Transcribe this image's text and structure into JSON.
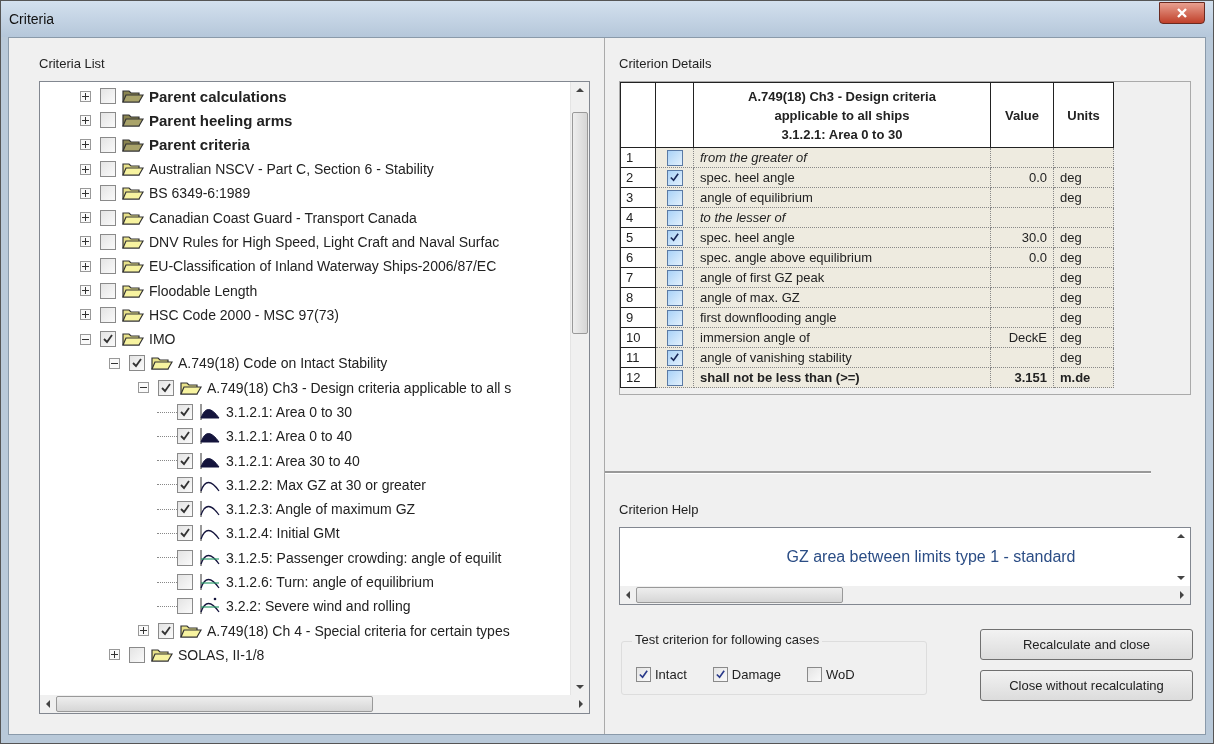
{
  "window": {
    "title": "Criteria"
  },
  "criteria_list": {
    "label": "Criteria List",
    "tree": [
      {
        "label": "Parent calculations",
        "kind": "parent-folder",
        "checked": false,
        "expanded": false
      },
      {
        "label": "Parent heeling arms",
        "kind": "parent-folder",
        "checked": false,
        "expanded": false
      },
      {
        "label": "Parent criteria",
        "kind": "parent-folder",
        "checked": false,
        "expanded": false
      },
      {
        "label": "Australian NSCV - Part C, Section 6 - Stability",
        "kind": "folder",
        "checked": false,
        "expanded": false
      },
      {
        "label": "BS 6349-6:1989",
        "kind": "folder",
        "checked": false,
        "expanded": false
      },
      {
        "label": "Canadian Coast Guard - Transport Canada",
        "kind": "folder",
        "checked": false,
        "expanded": false
      },
      {
        "label": "DNV Rules for High Speed, Light Craft and Naval Surfac",
        "kind": "folder",
        "checked": false,
        "expanded": false
      },
      {
        "label": "EU-Classification of Inland Waterway Ships-2006/87/EC",
        "kind": "folder",
        "checked": false,
        "expanded": false
      },
      {
        "label": "Floodable Length",
        "kind": "folder",
        "checked": false,
        "expanded": false
      },
      {
        "label": "HSC Code 2000 - MSC 97(73)",
        "kind": "folder",
        "checked": false,
        "expanded": false
      },
      {
        "label": "IMO",
        "kind": "folder",
        "checked": true,
        "expanded": true,
        "children": [
          {
            "label": "A.749(18) Code on Intact Stability",
            "kind": "folder",
            "checked": true,
            "expanded": true,
            "children": [
              {
                "label": "A.749(18) Ch3 - Design criteria applicable to all s",
                "kind": "folder",
                "checked": true,
                "expanded": true,
                "children": [
                  {
                    "label": "3.1.2.1: Area 0 to 30",
                    "kind": "area",
                    "checked": true
                  },
                  {
                    "label": "3.1.2.1: Area 0 to 40",
                    "kind": "area",
                    "checked": true
                  },
                  {
                    "label": "3.1.2.1: Area 30 to 40",
                    "kind": "area",
                    "checked": true
                  },
                  {
                    "label": "3.1.2.2: Max GZ at 30 or greater",
                    "kind": "curve",
                    "checked": true
                  },
                  {
                    "label": "3.1.2.3: Angle of maximum GZ",
                    "kind": "curve",
                    "checked": true
                  },
                  {
                    "label": "3.1.2.4: Initial GMt",
                    "kind": "curve",
                    "checked": true
                  },
                  {
                    "label": "3.1.2.5: Passenger crowding: angle of equilit",
                    "kind": "curve-heel",
                    "checked": false
                  },
                  {
                    "label": "3.1.2.6: Turn: angle of equilibrium",
                    "kind": "curve-heel",
                    "checked": false
                  },
                  {
                    "label": "3.2.2: Severe wind and rolling",
                    "kind": "curve-wind",
                    "checked": false
                  }
                ]
              },
              {
                "label": "A.749(18) Ch 4 - Special criteria for certain types",
                "kind": "folder",
                "checked": true,
                "expanded": false
              }
            ]
          },
          {
            "label": "SOLAS, II-1/8",
            "kind": "folder",
            "checked": false,
            "expanded": false
          }
        ]
      }
    ]
  },
  "criterion_details": {
    "label": "Criterion Details",
    "header": {
      "title": "A.749(18) Ch3 - Design criteria applicable to all ships",
      "subtitle": "3.1.2.1: Area 0 to 30",
      "value": "Value",
      "units": "Units"
    },
    "rows": [
      {
        "number": "1",
        "checked": false,
        "kind": "note",
        "label": "from the greater of"
      },
      {
        "number": "2",
        "checked": true,
        "kind": "param",
        "label": "spec. heel angle",
        "value": "0.0",
        "units": "deg"
      },
      {
        "number": "3",
        "checked": false,
        "kind": "param",
        "label": "angle of equilibrium",
        "units": "deg"
      },
      {
        "number": "4",
        "checked": false,
        "kind": "note",
        "label": "to the lesser of"
      },
      {
        "number": "5",
        "checked": true,
        "kind": "param",
        "label": "spec. heel angle",
        "value": "30.0",
        "units": "deg"
      },
      {
        "number": "6",
        "checked": false,
        "kind": "param",
        "label": "spec. angle above equilibrium",
        "value": "0.0",
        "units": "deg"
      },
      {
        "number": "7",
        "checked": false,
        "kind": "param",
        "label": "angle of first GZ peak",
        "units": "deg"
      },
      {
        "number": "8",
        "checked": false,
        "kind": "param",
        "label": "angle of max. GZ",
        "units": "deg"
      },
      {
        "number": "9",
        "checked": false,
        "kind": "param",
        "label": "first downflooding angle",
        "units": "deg"
      },
      {
        "number": "10",
        "checked": false,
        "kind": "param",
        "label": "immersion angle of",
        "value": "DeckE",
        "units": "deg"
      },
      {
        "number": "11",
        "checked": true,
        "kind": "param",
        "label": "angle of vanishing stability",
        "units": "deg"
      },
      {
        "number": "12",
        "checked": false,
        "kind": "requirement",
        "label": "shall not be less than (>=)",
        "value": "3.151",
        "units": "m.de"
      }
    ]
  },
  "criterion_help": {
    "label": "Criterion Help",
    "text": "GZ area between limits type 1 - standard"
  },
  "test_cases": {
    "label": "Test criterion for following cases",
    "options": [
      {
        "label": "Intact",
        "checked": true
      },
      {
        "label": "Damage",
        "checked": true
      },
      {
        "label": "WoD",
        "checked": false
      }
    ]
  },
  "buttons": [
    "Recalculate and close",
    "Close without recalculating"
  ]
}
